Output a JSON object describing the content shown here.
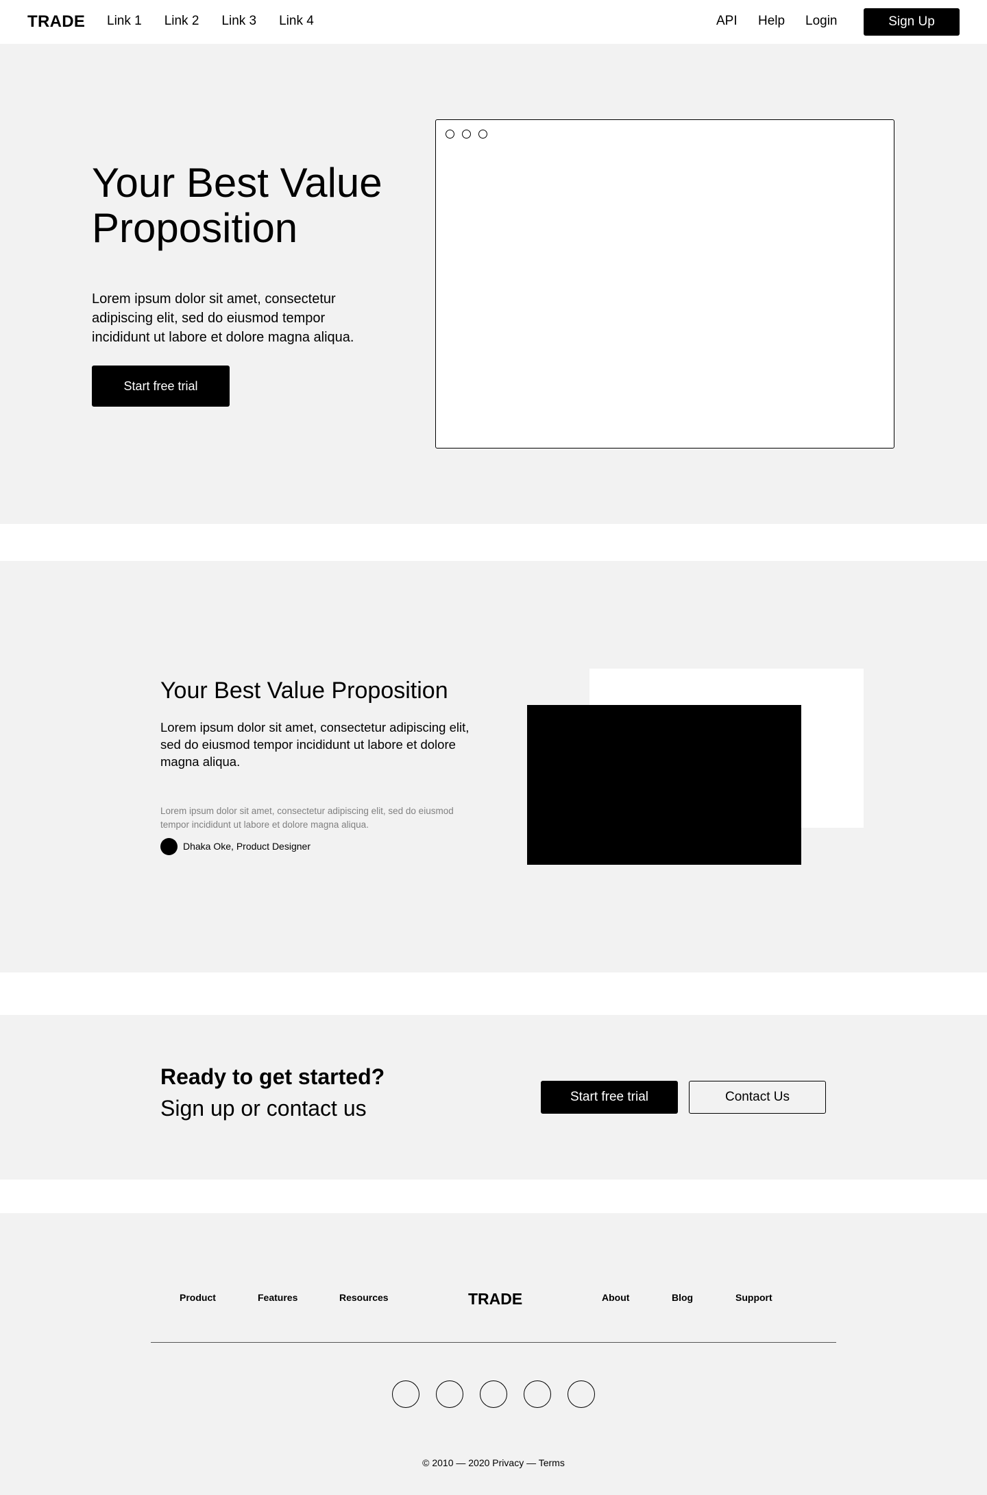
{
  "nav": {
    "logo": "TRADE",
    "links": [
      "Link 1",
      "Link 2",
      "Link 3",
      "Link 4"
    ],
    "right_links": [
      "API",
      "Help",
      "Login"
    ],
    "signup_label": "Sign Up"
  },
  "hero": {
    "title": "Your Best Value Proposition",
    "text": "Lorem ipsum dolor sit amet, consectetur adipiscing elit, sed do eiusmod tempor incididunt ut labore et dolore magna aliqua.",
    "cta_label": "Start free trial"
  },
  "feature": {
    "title": "Your Best Value Proposition",
    "text": "Lorem ipsum dolor sit amet, consectetur adipiscing elit, sed do eiusmod tempor incididunt ut labore et dolore magna aliqua.",
    "quote": "Lorem ipsum dolor sit amet, consectetur adipiscing elit, sed do eiusmod tempor incididunt ut labore et dolore magna aliqua.",
    "author": "Dhaka Oke, Product Designer"
  },
  "cta": {
    "title": "Ready to get started?",
    "subtitle": "Sign up or contact us",
    "primary_label": "Start free trial",
    "secondary_label": "Contact Us"
  },
  "footer": {
    "left_links": [
      "Product",
      "Features",
      "Resources"
    ],
    "logo": "TRADE",
    "right_links": [
      "About",
      "Blog",
      "Support"
    ],
    "copyright": "© 2010 — 2020   Privacy — Terms"
  },
  "colors": {
    "background": "#ffffff",
    "section": "#f2f2f2",
    "primary": "#000000",
    "muted_text": "#808080"
  }
}
